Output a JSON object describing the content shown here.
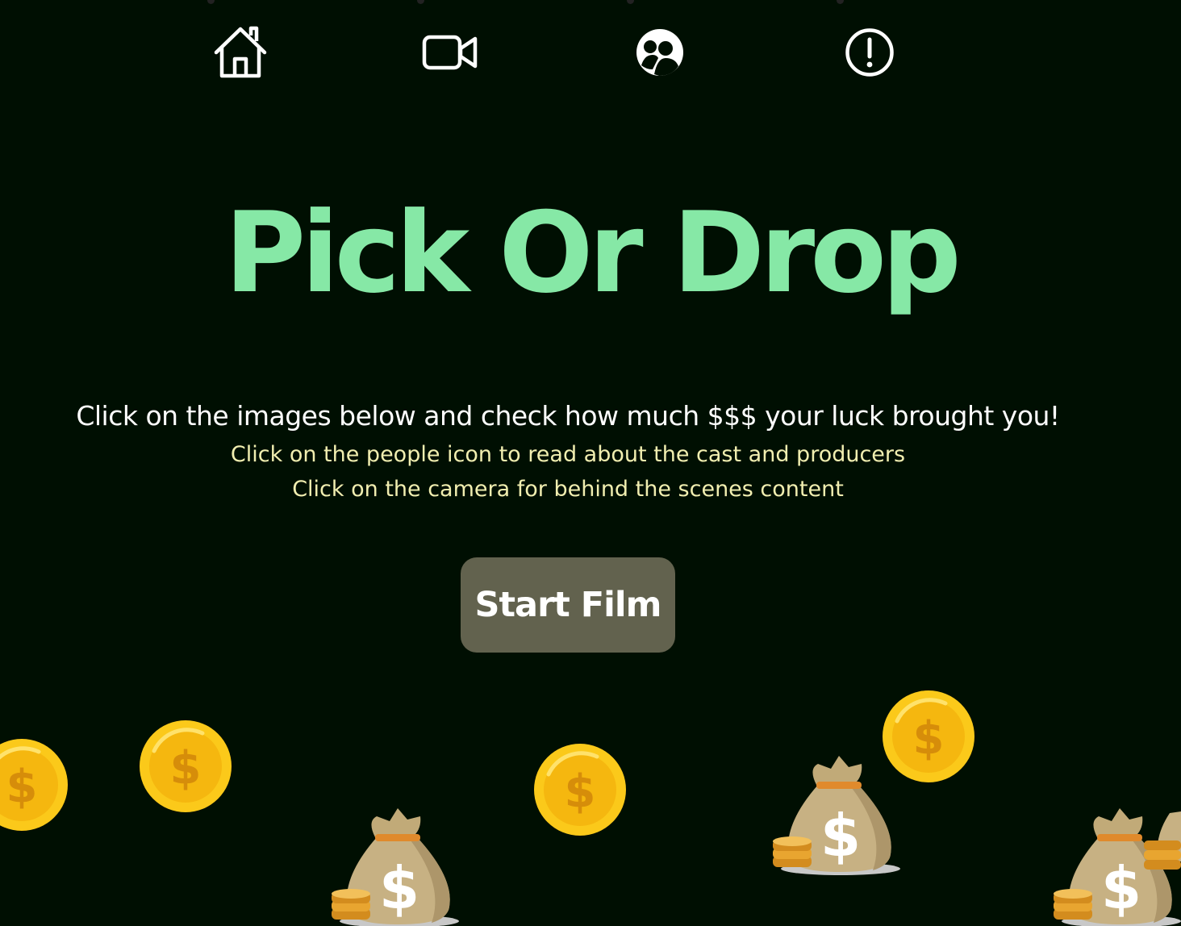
{
  "nav": {
    "items": [
      {
        "icon": "home-icon"
      },
      {
        "icon": "video-camera-icon"
      },
      {
        "icon": "people-icon"
      },
      {
        "icon": "info-alert-icon"
      }
    ]
  },
  "hero": {
    "title": "Pick Or Drop",
    "subtitle": "Click on the images below and check how much $$$ your luck brought you!",
    "hint_people": "Click on the people icon to read about the cast and producers",
    "hint_camera": "Click on the camera for behind the scenes content"
  },
  "actions": {
    "start_label": "Start Film"
  },
  "images": {
    "coin_symbol": "$",
    "bag_symbol": "$"
  },
  "colors": {
    "background": "#000f02",
    "title": "#86e8a6",
    "hint": "#f1eeb0",
    "button": "#62624e",
    "coin": "#fbc91a"
  }
}
